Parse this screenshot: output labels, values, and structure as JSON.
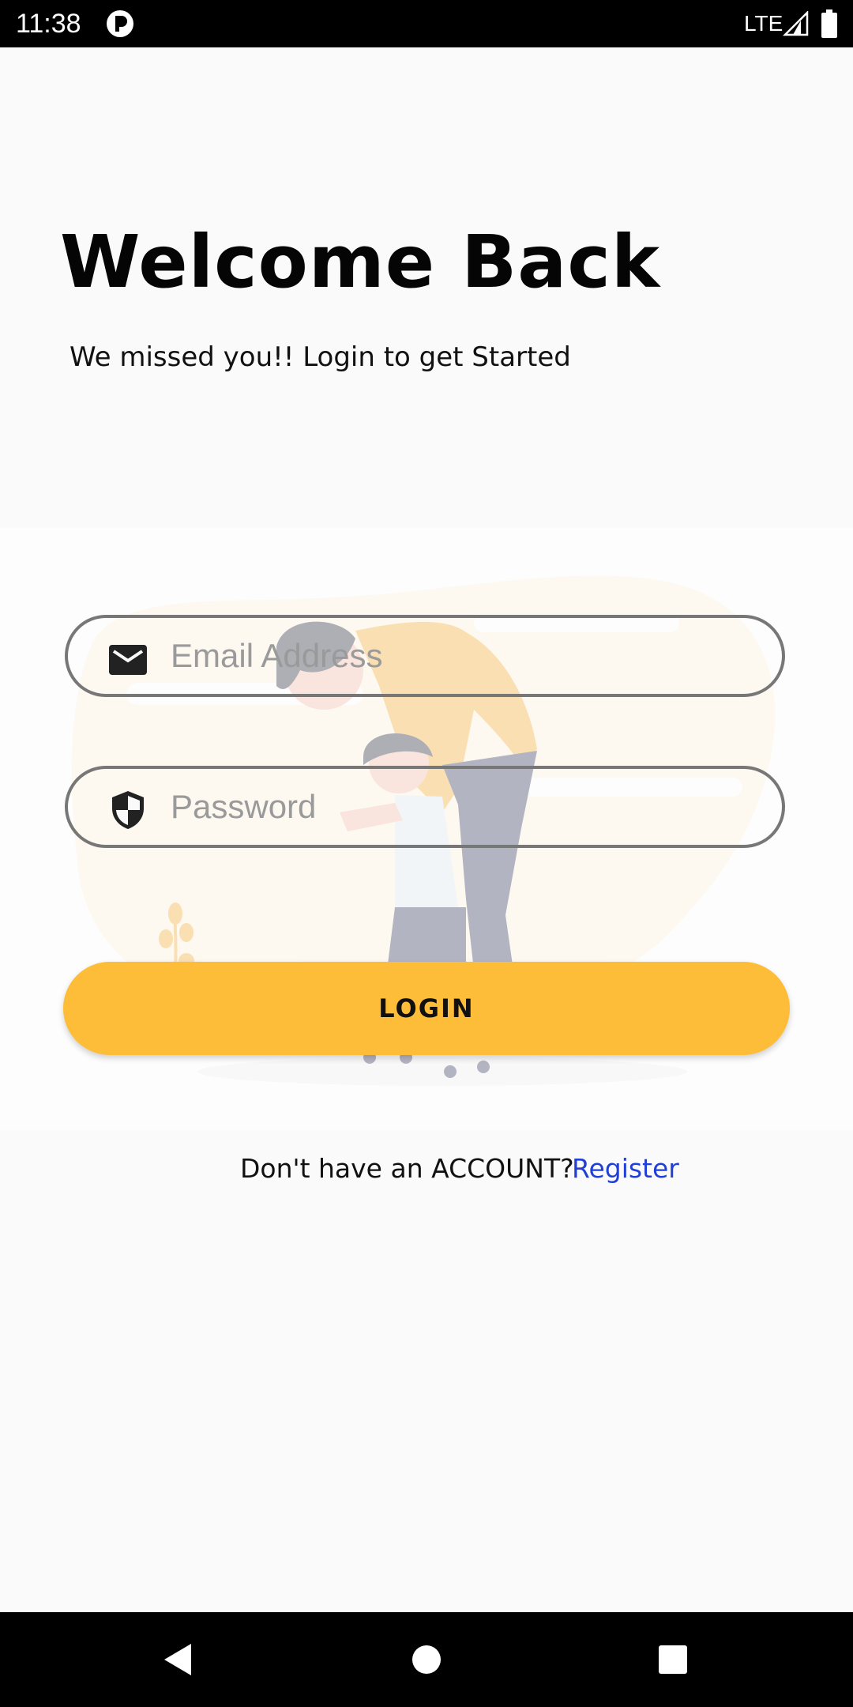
{
  "status_bar": {
    "time": "11:38",
    "network": "LTE",
    "app_icon": "circle-p-icon",
    "signal_icon": "signal-icon",
    "battery_icon": "battery-icon"
  },
  "header": {
    "title": "Welcome Back",
    "subtitle": "We missed you!! Login to get Started"
  },
  "illustration": {
    "icon": "parent-child-illustration",
    "accent_color": "#fdbd39"
  },
  "form": {
    "email": {
      "placeholder": "Email Address",
      "value": "",
      "icon": "mail-icon"
    },
    "password": {
      "placeholder": "Password",
      "value": "",
      "icon": "shield-icon"
    },
    "login_label": "LOGIN",
    "login_color": "#fdbd39"
  },
  "register": {
    "prompt": "Don't have an ACCOUNT?",
    "link_label": "Register",
    "link_color": "#1f3fd6"
  },
  "nav_bar": {
    "back_icon": "back-triangle-icon",
    "home_icon": "home-circle-icon",
    "recents_icon": "recents-square-icon"
  }
}
